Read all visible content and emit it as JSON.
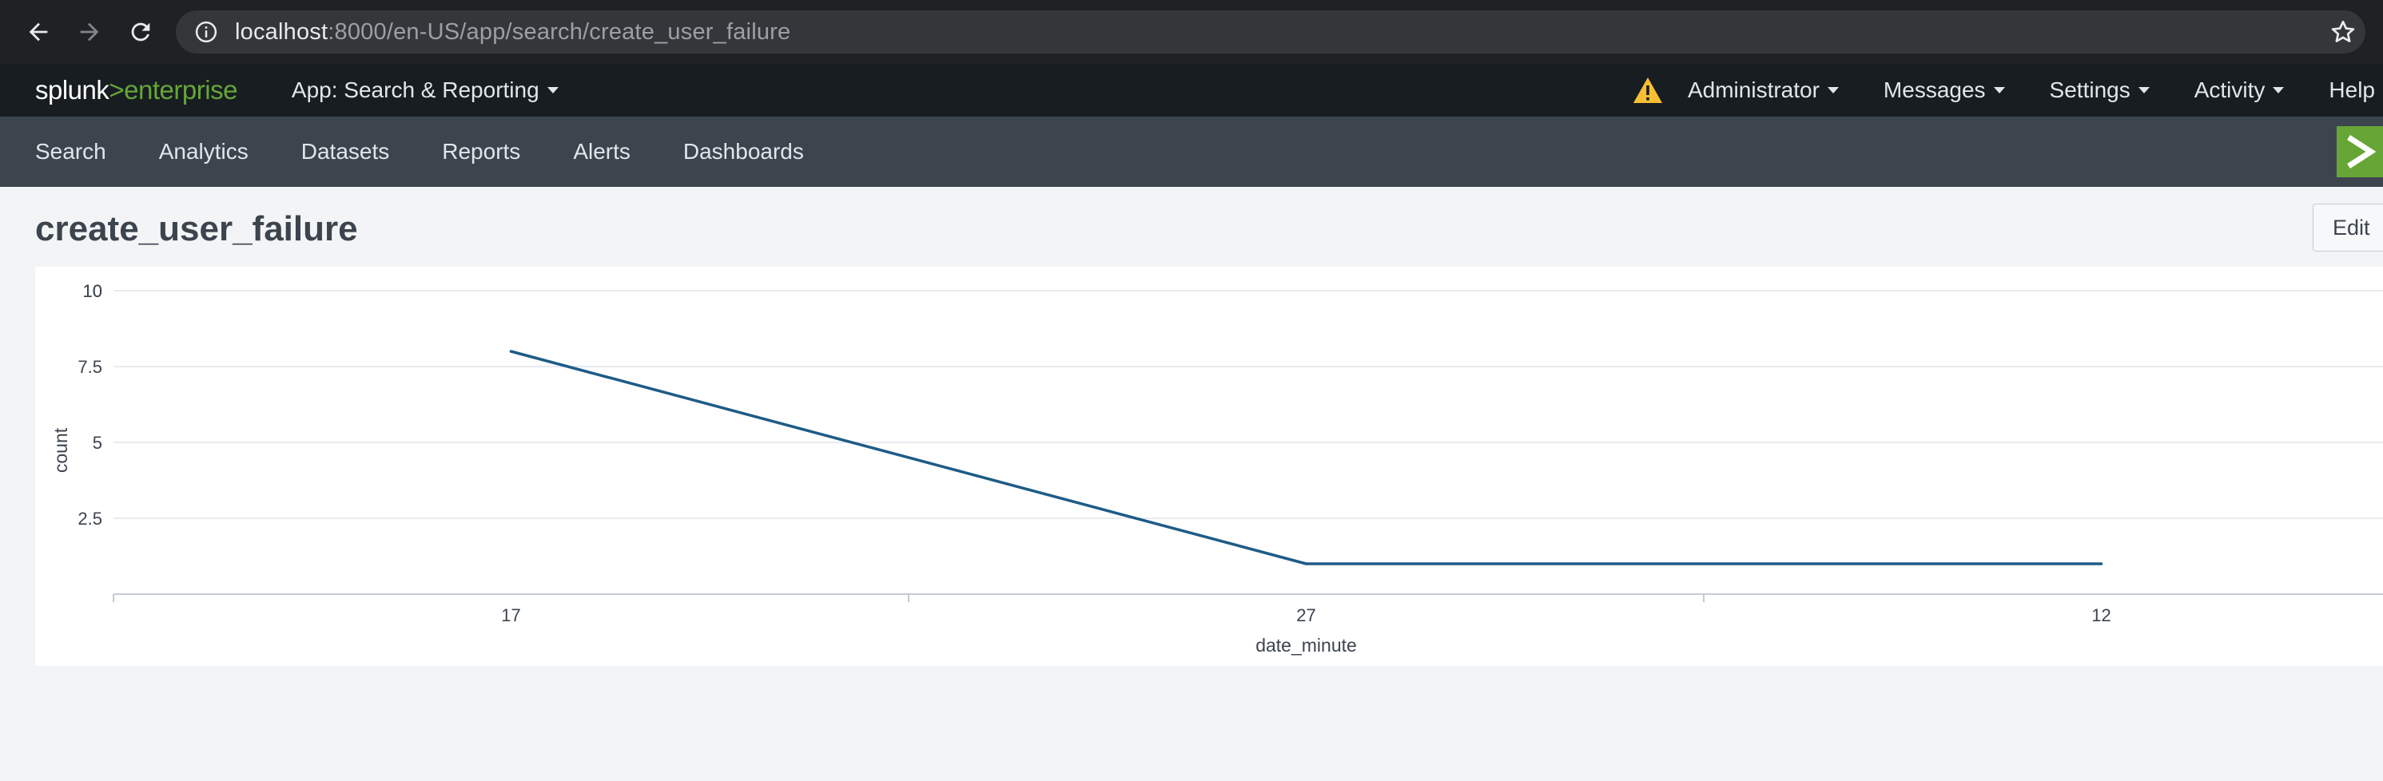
{
  "browser": {
    "url_host": "localhost",
    "url_rest": ":8000/en-US/app/search/create_user_failure",
    "icons": {
      "back": "arrow-left-icon",
      "forward": "arrow-right-icon",
      "reload": "reload-icon",
      "info": "info-icon",
      "bookmark": "star-icon"
    }
  },
  "splunk_bar": {
    "logo_brand": "splunk",
    "logo_sep": ">",
    "logo_product": "enterprise",
    "app_menu": "App: Search & Reporting",
    "right_menu": {
      "administrator": "Administrator",
      "messages": "Messages",
      "settings": "Settings",
      "activity": "Activity",
      "help": "Help"
    },
    "accent_color": "#65a637",
    "warning_color": "#f8be34"
  },
  "app_nav": {
    "items": [
      "Search",
      "Analytics",
      "Datasets",
      "Reports",
      "Alerts",
      "Dashboards"
    ],
    "badge": ">"
  },
  "page": {
    "title": "create_user_failure",
    "edit_label": "Edit"
  },
  "chart_data": {
    "type": "line",
    "categories": [
      "17",
      "27",
      "12"
    ],
    "series": [
      {
        "values": [
          8,
          1,
          1
        ]
      }
    ],
    "xlabel": "date_minute",
    "ylabel": "count",
    "yticks": [
      "2.5",
      "5",
      "7.5",
      "10"
    ],
    "ylim": [
      0,
      10
    ],
    "grid": true,
    "line_color": "#1e5b86"
  }
}
